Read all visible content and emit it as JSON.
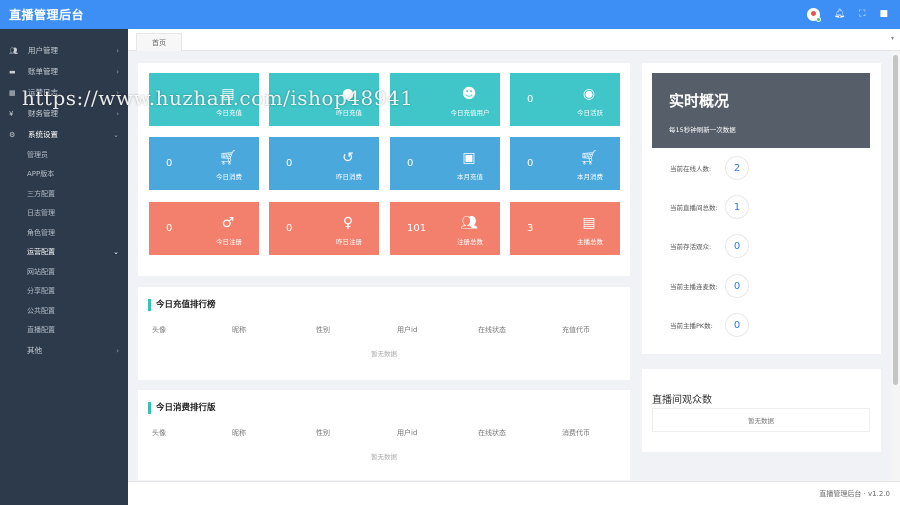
{
  "app": {
    "title": "直播管理后台"
  },
  "topbar": {
    "icons": [
      "avatar",
      "bell-icon",
      "fullscreen-icon",
      "square-icon"
    ]
  },
  "sidebar": {
    "items": [
      {
        "label": "用户管理",
        "icon": "users-icon",
        "arrow": "›"
      },
      {
        "label": "账单管理",
        "icon": "video-icon",
        "arrow": "›"
      },
      {
        "label": "运营日志",
        "icon": "calendar-icon",
        "arrow": "›"
      },
      {
        "label": "财务管理",
        "icon": "yen-icon",
        "arrow": "›"
      },
      {
        "label": "系统设置",
        "icon": "gear-icon",
        "arrow": "⌄"
      }
    ],
    "sub1": [
      "管理员",
      "APP版本",
      "三方配置",
      "日志管理",
      "角色管理"
    ],
    "group2": {
      "label": "运营配置",
      "arrow": "⌄"
    },
    "sub2": [
      "网站配置",
      "分享配置",
      "公共配置",
      "直播配置"
    ],
    "last": {
      "label": "其他",
      "arrow": "›"
    }
  },
  "tabs": {
    "home": "首页",
    "caret": "▾"
  },
  "stats": [
    {
      "value": "",
      "label": "今日充值",
      "icon": "document-icon",
      "color": "#40c5c8"
    },
    {
      "value": "",
      "label": "昨日充值",
      "icon": "coin-icon",
      "color": "#40c5c8"
    },
    {
      "value": "",
      "label": "今日充值用户",
      "icon": "user-plus-icon",
      "color": "#40c5c8"
    },
    {
      "value": "0",
      "label": "今日活跃",
      "icon": "user-circle-icon",
      "color": "#40c5c8"
    },
    {
      "value": "0",
      "label": "今日消费",
      "icon": "cart-icon",
      "color": "#4aa8dc"
    },
    {
      "value": "0",
      "label": "昨日消费",
      "icon": "history-icon",
      "color": "#4aa8dc"
    },
    {
      "value": "0",
      "label": "本月充值",
      "icon": "id-card-icon",
      "color": "#4aa8dc"
    },
    {
      "value": "0",
      "label": "本月消费",
      "icon": "cart-icon",
      "color": "#4aa8dc"
    },
    {
      "value": "0",
      "label": "今日注册",
      "icon": "male-icon",
      "color": "#f2806c"
    },
    {
      "value": "0",
      "label": "昨日注册",
      "icon": "female-icon",
      "color": "#f2806c"
    },
    {
      "value": "101",
      "label": "注册总数",
      "icon": "users-icon",
      "color": "#f2806c"
    },
    {
      "value": "3",
      "label": "主播总数",
      "icon": "contact-card-icon",
      "color": "#f2806c"
    }
  ],
  "recharge_rank": {
    "title": "今日充值排行榜",
    "columns": [
      "头像",
      "昵称",
      "性别",
      "用户id",
      "在线状态",
      "充值代币"
    ],
    "empty": "暂无数据"
  },
  "consume_rank": {
    "title": "今日消费排行版",
    "columns": [
      "头像",
      "昵称",
      "性别",
      "用户id",
      "在线状态",
      "消费代币"
    ],
    "empty": "暂无数据"
  },
  "realtime": {
    "title": "实时概况",
    "subtitle": "每15秒钟刷新一次数据",
    "rows": [
      {
        "label": "当前在线人数:",
        "value": "2"
      },
      {
        "label": "当前直播间总数:",
        "value": "1"
      },
      {
        "label": "当前存活观众:",
        "value": "0"
      },
      {
        "label": "当前主播连麦数:",
        "value": "0"
      },
      {
        "label": "当前主播PK数:",
        "value": "0"
      }
    ]
  },
  "viewers": {
    "title": "直播间观众数",
    "empty": "暂无数据"
  },
  "footer": {
    "text": "直播管理后台 · v1.2.0"
  },
  "watermark": "https://www.huzhan.com/ishop48941"
}
